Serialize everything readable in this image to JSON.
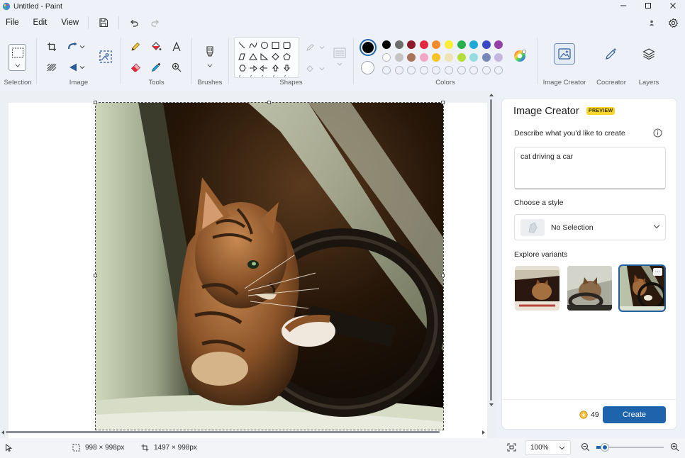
{
  "window": {
    "title": "Untitled - Paint"
  },
  "menu": {
    "items": [
      "File",
      "Edit",
      "View"
    ]
  },
  "ribbon": {
    "groups": {
      "selection": "Selection",
      "image": "Image",
      "tools": "Tools",
      "brushes": "Brushes",
      "shapes": "Shapes",
      "colors": "Colors",
      "image_creator": "Image Creator",
      "cocreator": "Cocreator",
      "layers": "Layers"
    },
    "palette_row1": [
      "#000000",
      "#6e6e6e",
      "#8a1b2a",
      "#e0293a",
      "#f28c2b",
      "#fbee35",
      "#27b04b",
      "#1fa8d8",
      "#3b48c4",
      "#9540a8"
    ],
    "palette_row2": [
      "#ffffff",
      "#c4c4c4",
      "#a8735a",
      "#f4a6c6",
      "#f6c328",
      "#eee3b3",
      "#b5de3c",
      "#93dcdf",
      "#7688b5",
      "#c5b6df"
    ],
    "primary_color": "#000000",
    "secondary_color": "#ffffff"
  },
  "panel": {
    "title": "Image Creator",
    "badge": "PREVIEW",
    "describe_label": "Describe what you'd like to create",
    "prompt_value": "cat driving a car",
    "style_label": "Choose a style",
    "style_value": "No Selection",
    "variants_label": "Explore variants",
    "variants_count": 3,
    "selected_variant": 3,
    "credits": "49",
    "create_label": "Create"
  },
  "status": {
    "selection_size": "998 × 998px",
    "canvas_size": "1497 × 998px",
    "zoom": "100%"
  }
}
